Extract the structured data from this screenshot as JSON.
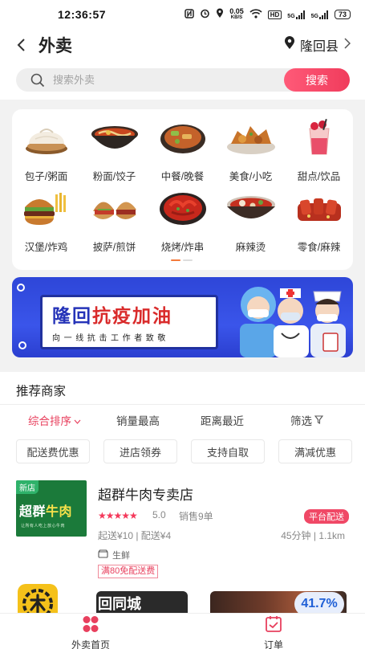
{
  "status_bar": {
    "time": "12:36:57",
    "net_speed": "0.05",
    "net_unit": "KB/S",
    "hd": "HD",
    "signal1": "5G",
    "signal2": "5G",
    "battery": "73"
  },
  "header": {
    "title": "外卖",
    "location": "隆回县"
  },
  "search": {
    "placeholder": "搜索外卖",
    "button": "搜索"
  },
  "categories": [
    {
      "label": "包子/粥面",
      "icon": "baozi-icon"
    },
    {
      "label": "粉面/饺子",
      "icon": "noodle-bowl-icon"
    },
    {
      "label": "中餐/晚餐",
      "icon": "dish-icon"
    },
    {
      "label": "美食/小吃",
      "icon": "snack-icon"
    },
    {
      "label": "甜点/饮品",
      "icon": "drink-icon"
    },
    {
      "label": "汉堡/炸鸡",
      "icon": "burger-icon"
    },
    {
      "label": "披萨/煎饼",
      "icon": "pancake-icon"
    },
    {
      "label": "烧烤/炸串",
      "icon": "crayfish-icon"
    },
    {
      "label": "麻辣烫",
      "icon": "hotpot-icon"
    },
    {
      "label": "零食/麻辣",
      "icon": "spicy-snack-icon"
    }
  ],
  "banner": {
    "title_part1": "隆回",
    "title_part2": "抗疫加油",
    "subtitle": "向一线抗击工作者致敬"
  },
  "merchants": {
    "section_title": "推荐商家",
    "sort": [
      "综合排序",
      "销量最高",
      "距离最近",
      "筛选"
    ],
    "filters": [
      "配送费优惠",
      "进店领券",
      "支持自取",
      "满减优惠"
    ],
    "store": {
      "badge": "新店",
      "logo_text_1": "超群",
      "logo_text_2": "牛肉",
      "logo_slogan": "让所有人吃上放心牛肉",
      "name": "超群牛肉专卖店",
      "stars": "★★★★★",
      "rating": "5.0",
      "sales": "销售9单",
      "platform": "平台配送",
      "delivery": "起送¥10 | 配送¥4",
      "eta": "45分钟 | 1.1km",
      "tag": "生鲜",
      "promo": "满80免配送费"
    },
    "thumb_text": "回同城",
    "percent": "41.7%"
  },
  "bottom_nav": {
    "home": "外卖首页",
    "orders": "订单"
  },
  "colors": {
    "accent": "#f03c5c",
    "banner_blue": "#3a55ea",
    "green": "#1b7a3a"
  }
}
